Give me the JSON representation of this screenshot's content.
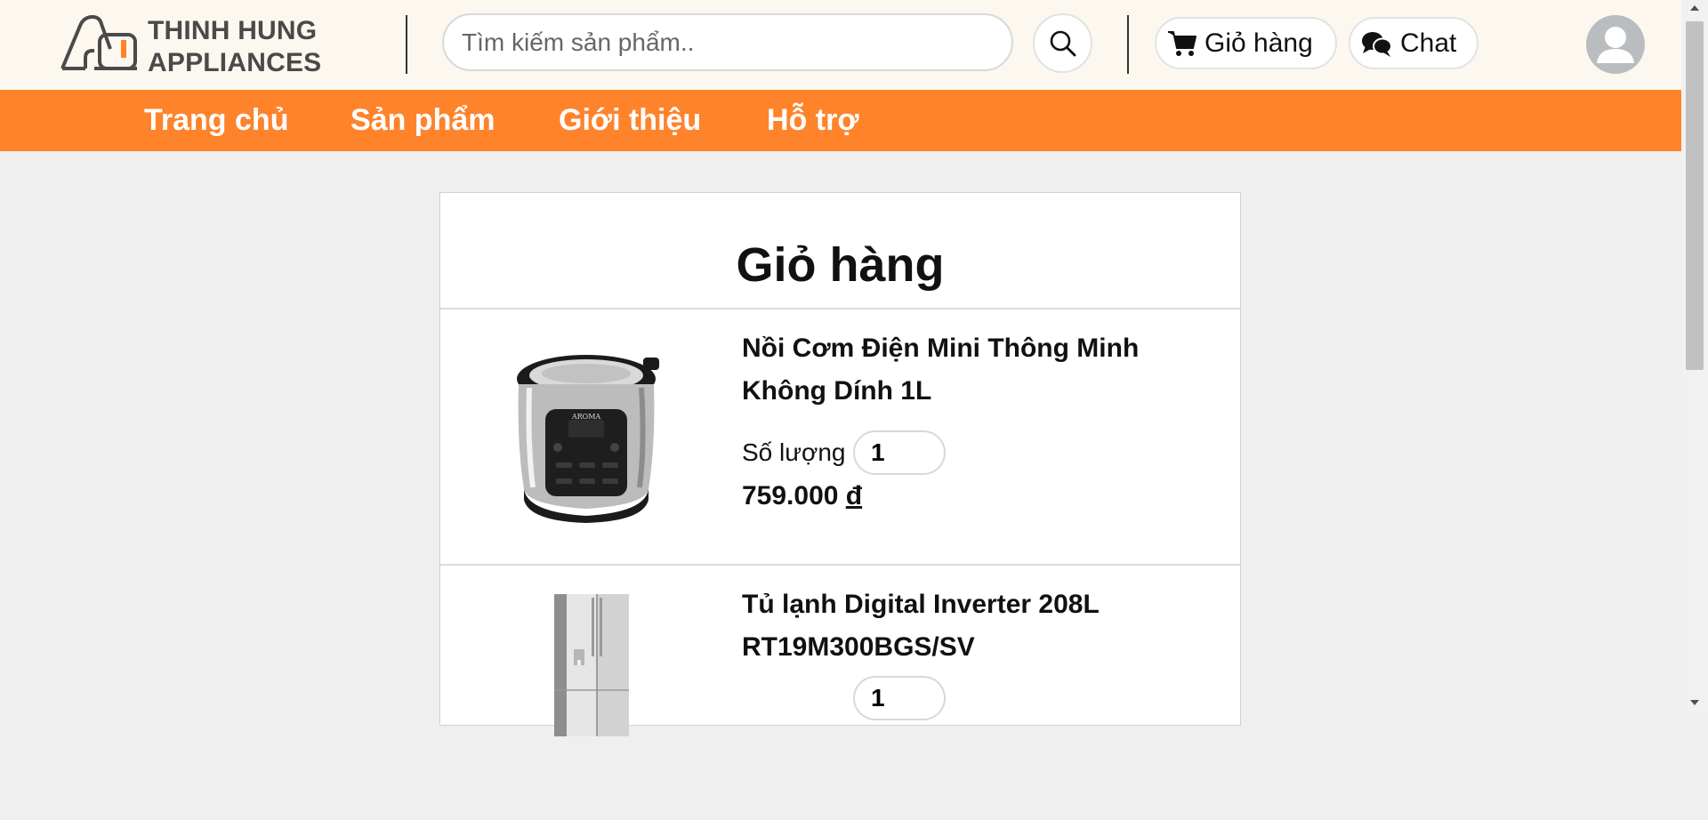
{
  "brand": {
    "line1": "THINH HUNG",
    "line2": "APPLIANCES"
  },
  "search": {
    "placeholder": "Tìm kiếm sản phẩm.."
  },
  "header": {
    "cart_label": "Giỏ hàng",
    "chat_label": "Chat"
  },
  "nav": {
    "items": [
      {
        "label": "Trang chủ"
      },
      {
        "label": "Sản phẩm"
      },
      {
        "label": "Giới thiệu"
      },
      {
        "label": "Hỗ trợ"
      }
    ]
  },
  "cart": {
    "title": "Giỏ hàng",
    "quantity_label": "Số lượng",
    "items": [
      {
        "name": "Nồi Cơm Điện Mini Thông Minh Không Dính 1L",
        "quantity": "1",
        "price": "759.000",
        "currency": "đ",
        "brand_on_image": "AROMA"
      },
      {
        "name": "Tủ lạnh Digital Inverter 208L RT19M300BGS/SV",
        "quantity": "1"
      }
    ]
  },
  "colors": {
    "accent": "#ff832b",
    "header_bg": "#fdf8ef",
    "page_bg": "#efefef"
  }
}
